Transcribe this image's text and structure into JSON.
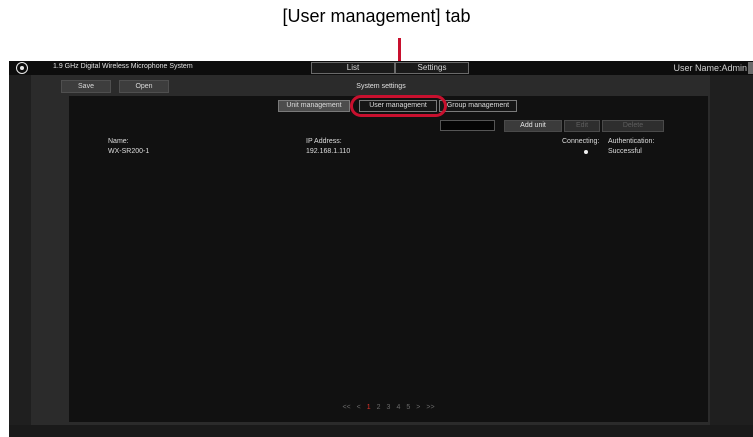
{
  "annotation": {
    "label": "[User management] tab",
    "color": "#c8102e"
  },
  "titlebar": {
    "app_icon": "disc-icon",
    "title": "1.9 GHz Digital Wireless Microphone System",
    "tabs": [
      {
        "label": "List"
      },
      {
        "label": "Settings"
      }
    ],
    "user_name": "User Name:Admin"
  },
  "toolbar": {
    "save_label": "Save",
    "open_label": "Open"
  },
  "panel": {
    "title": "System settings",
    "subtabs": [
      {
        "label": "Unit management",
        "active": true
      },
      {
        "label": "User management",
        "active": false
      },
      {
        "label": "Group management",
        "active": false
      }
    ],
    "search_value": "",
    "actions": {
      "add_label": "Add unit",
      "edit_label": "Edit",
      "delete_label": "Delete"
    },
    "table": {
      "columns": [
        "Name:",
        "IP Address:",
        "Connecting:",
        "Authentication:"
      ],
      "rows": [
        {
          "name": "WX-SR200-1",
          "ip": "192.168.1.110",
          "connecting": "connected-dot-icon",
          "authentication": "Successful"
        }
      ]
    },
    "pagination": {
      "first": "<<",
      "prev": "<",
      "pages": [
        "1",
        "2",
        "3",
        "4",
        "5"
      ],
      "current": "1",
      "next": ">",
      "last": ">>"
    }
  }
}
